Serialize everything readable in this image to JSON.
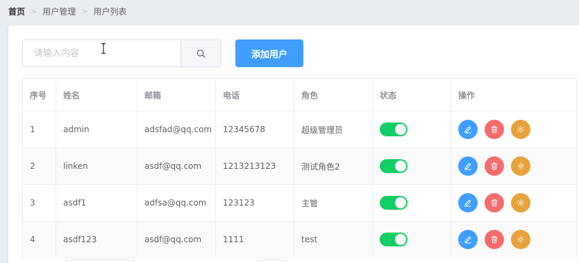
{
  "breadcrumb": {
    "items": [
      "首页",
      "用户管理",
      "用户列表"
    ]
  },
  "search": {
    "placeholder": "请输入内容",
    "value": "",
    "icon": "search-icon"
  },
  "toolbar": {
    "add_label": "添加用户"
  },
  "table": {
    "headers": [
      "序号",
      "姓名",
      "邮箱",
      "电话",
      "角色",
      "状态",
      "操作"
    ],
    "rows": [
      {
        "index": "1",
        "name": "admin",
        "email": "adsfad@qq.com",
        "phone": "12345678",
        "role": "超级管理员",
        "status": true
      },
      {
        "index": "2",
        "name": "linken",
        "email": "asdf@qq.com",
        "phone": "1213213123",
        "role": "测试角色2",
        "status": true
      },
      {
        "index": "3",
        "name": "asdf1",
        "email": "adfsa@qq.com",
        "phone": "123123",
        "role": "主管",
        "status": true
      },
      {
        "index": "4",
        "name": "asdf123",
        "email": "asdf@qq.com",
        "phone": "1111",
        "role": "test",
        "status": true
      }
    ],
    "actions": [
      "edit-icon",
      "delete-icon",
      "settings-icon"
    ]
  },
  "colors": {
    "primary": "#409eff",
    "switch_on": "#13ce66",
    "danger": "#f56c6c",
    "warning": "#e6a23c"
  }
}
